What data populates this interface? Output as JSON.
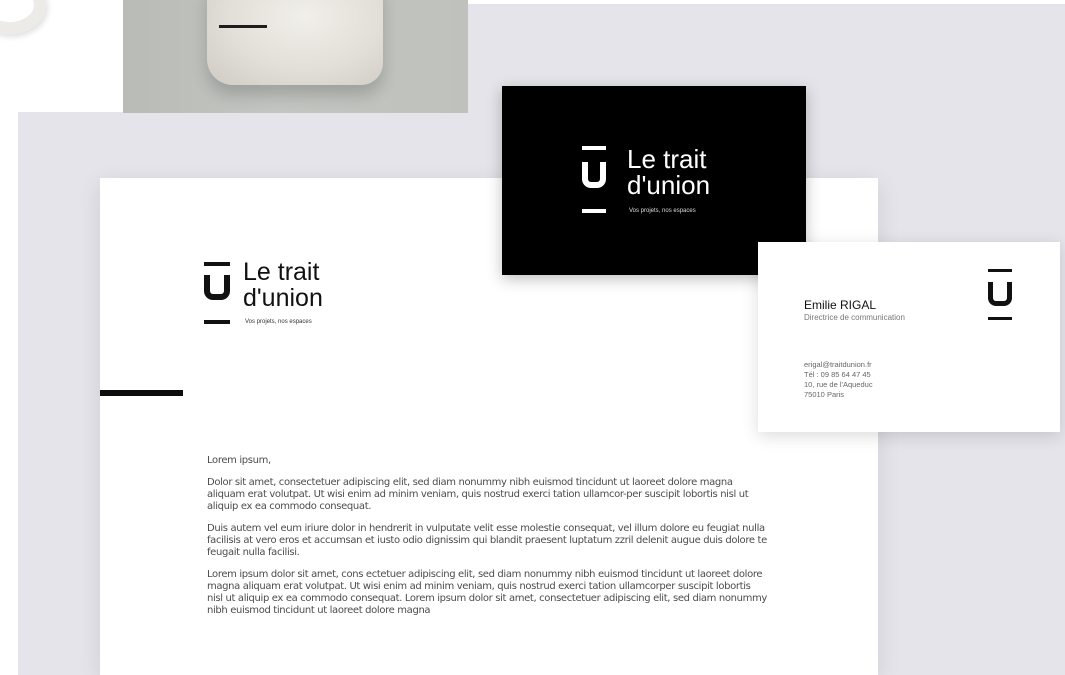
{
  "colors": {
    "backdrop": "#e4e4ea",
    "ink": "#111111",
    "card_black": "#000000",
    "paper": "#ffffff",
    "body_text": "#4c4c4c"
  },
  "brand": {
    "name_line1": "Le trait",
    "name_line2": "d'union",
    "tagline": "Vos projets, nos espaces",
    "logo_icon": "u-letter-logo-icon"
  },
  "letter": {
    "greeting": "Lorem ipsum,",
    "paragraphs": [
      "Dolor sit amet, consectetuer adipiscing elit, sed diam nonummy nibh euismod tincidunt ut laoreet dolore magna aliquam erat volutpat. Ut wisi enim ad minim veniam, quis nostrud exerci tation ullamcor-per suscipit lobortis nisl ut aliquip ex ea commodo consequat.",
      "Duis autem vel eum iriure dolor in hendrerit in vulputate velit esse molestie consequat, vel illum dolore eu feugiat nulla facilisis at vero eros et accumsan et iusto odio dignissim qui blandit praesent luptatum zzril delenit augue duis dolore te feugait nulla facilisi.",
      "Lorem ipsum dolor sit amet, cons ectetuer adipiscing elit, sed diam nonummy nibh euismod tincidunt ut laoreet dolore magna aliquam erat volutpat. Ut wisi enim ad minim veniam, quis nostrud exerci tation ullamcorper suscipit lobortis nisl ut aliquip ex ea commodo consequat. Lorem ipsum dolor sit amet, consectetuer adipiscing elit, sed diam nonummy nibh euismod tincidunt ut laoreet dolore magna"
    ]
  },
  "business_card": {
    "name": "Emilie RIGAL",
    "role": "Directrice de communication",
    "email": "erigal@traitdunion.fr",
    "phone": "Tél : 09 85 64 47 45",
    "address_line1": "10, rue de l'Aqueduc",
    "address_line2": "75010 Paris"
  }
}
